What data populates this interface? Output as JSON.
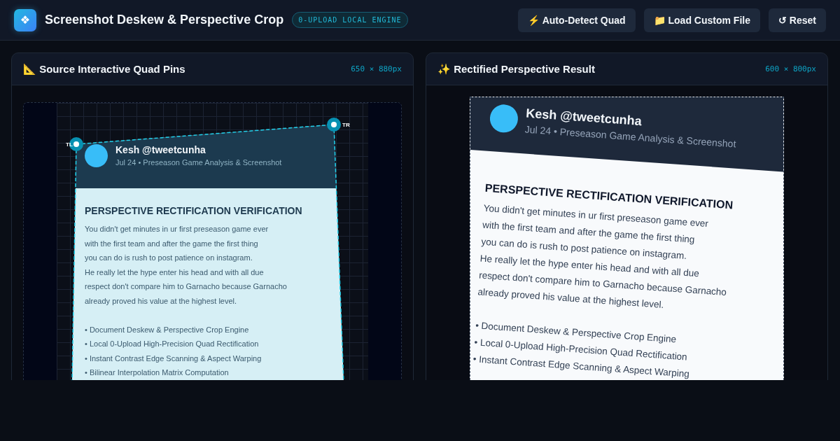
{
  "header": {
    "logo_glyph": "❖",
    "title": "Screenshot Deskew & Perspective Crop",
    "badge": "0-UPLOAD LOCAL ENGINE",
    "buttons": [
      {
        "icon": "⚡",
        "label": "Auto-Detect Quad"
      },
      {
        "icon": "📁",
        "label": "Load Custom File"
      },
      {
        "icon": "↺",
        "label": "Reset"
      }
    ]
  },
  "source_panel": {
    "icon": "📐",
    "title": "Source Interactive Quad Pins",
    "dimensions": "650 × 880px",
    "pins": [
      {
        "label": "TL"
      },
      {
        "label": "TR"
      }
    ],
    "document": {
      "author": "Kesh @tweetcunha",
      "meta": "Jul 24 • Preseason Game Analysis & Screenshot",
      "heading": "PERSPECTIVE RECTIFICATION VERIFICATION",
      "lines": [
        "You didn't get minutes in ur first preseason game ever",
        "with the first team and after the game the first thing",
        "you can do is rush to post patience on instagram.",
        "He really let the hype enter his head and with all due",
        "respect don't compare him to Garnacho because Garnacho",
        "already proved his value at the highest level."
      ],
      "bullets": [
        "• Document Deskew & Perspective Crop Engine",
        "• Local 0-Upload High-Precision Quad Rectification",
        "• Instant Contrast Edge Scanning & Aspect Warping",
        "• Bilinear Interpolation Matrix Computation"
      ]
    }
  },
  "result_panel": {
    "icon": "✨",
    "title": "Rectified Perspective Result",
    "dimensions": "600 × 800px",
    "document": {
      "author": "Kesh @tweetcunha",
      "meta": "Jul 24 • Preseason Game Analysis & Screenshot",
      "heading": "PERSPECTIVE RECTIFICATION VERIFICATION",
      "lines": [
        "You didn't get minutes in ur first preseason game ever",
        "with the first team and after the game the first thing",
        "you can do is rush to post patience on instagram.",
        "He really let the hype enter his head and with all due",
        "respect don't compare him to Garnacho because Garnacho",
        "already proved his value at the highest level."
      ],
      "bullets": [
        "• Document Deskew & Perspective Crop Engine",
        "• Local 0-Upload High-Precision Quad Rectification",
        "• Instant Contrast Edge Scanning & Aspect Warping"
      ]
    }
  }
}
